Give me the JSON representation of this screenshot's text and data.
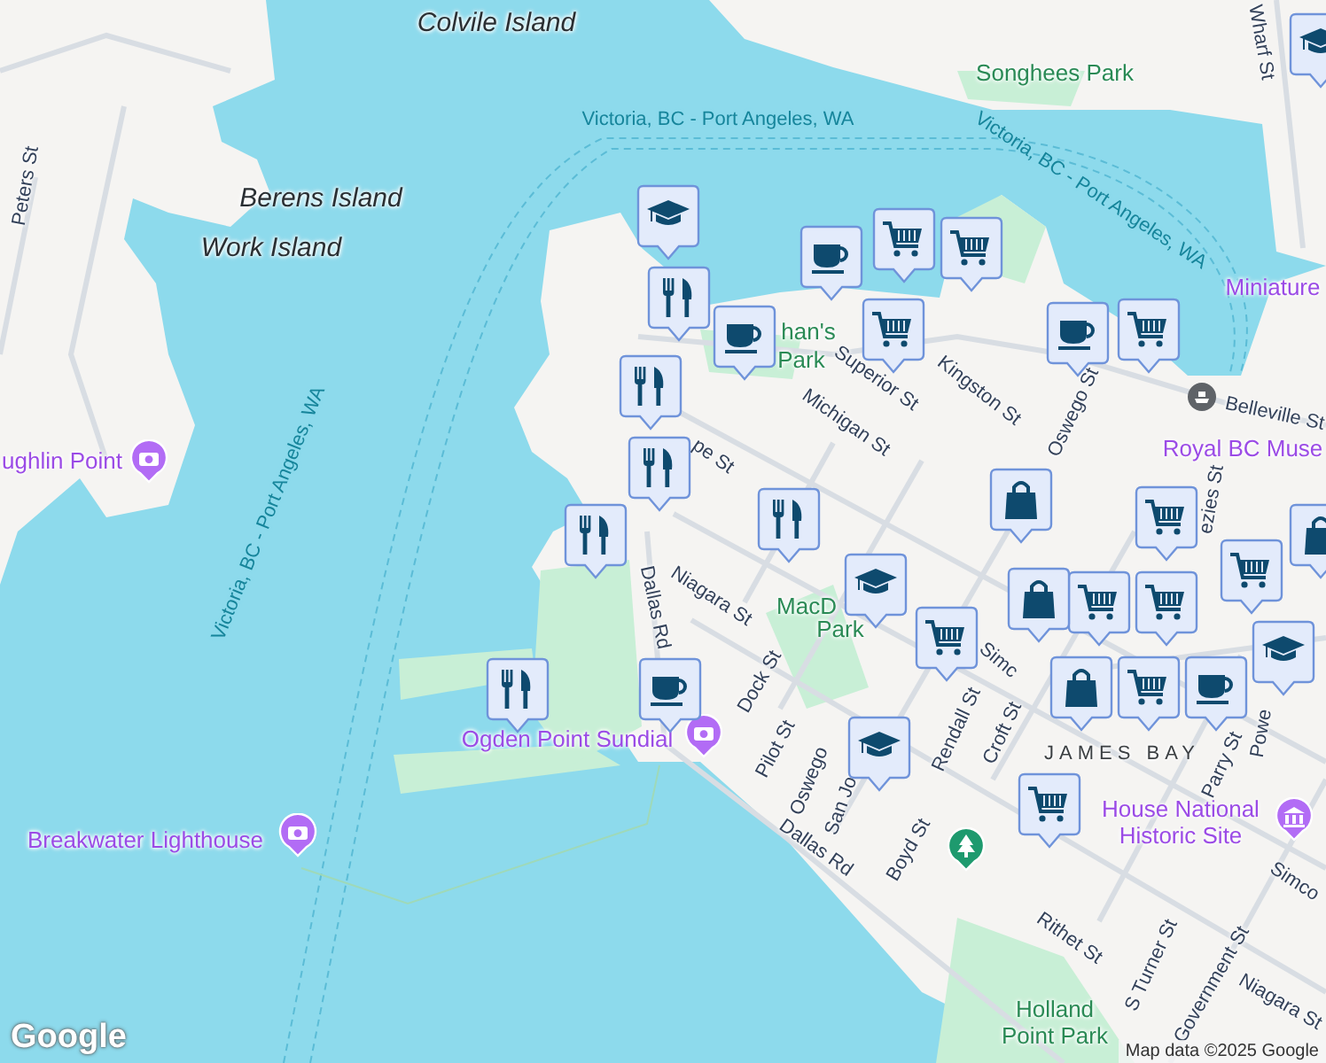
{
  "labels": [
    {
      "text": "Colvile Island",
      "kind": "island"
    },
    {
      "text": "Berens Island",
      "kind": "island"
    },
    {
      "text": "Work Island",
      "kind": "island"
    },
    {
      "text": "Victoria, BC - Port Angeles, WA",
      "kind": "route"
    },
    {
      "text": "Victoria, BC - Port Angeles, WA",
      "kind": "route"
    },
    {
      "text": "Victoria, BC - Port Angeles, WA",
      "kind": "route"
    },
    {
      "text": "Peters St",
      "kind": "street"
    },
    {
      "text": "Songhees Park",
      "kind": "park"
    },
    {
      "text": "han's",
      "kind": "park"
    },
    {
      "text": "Park",
      "kind": "park"
    },
    {
      "text": "Superior St",
      "kind": "street"
    },
    {
      "text": "Kingston St",
      "kind": "street"
    },
    {
      "text": "Michigan St",
      "kind": "street"
    },
    {
      "text": "Oswego St",
      "kind": "street"
    },
    {
      "text": "Belleville St",
      "kind": "street"
    },
    {
      "text": "pe St",
      "kind": "street"
    },
    {
      "text": "Miniature",
      "kind": "poi"
    },
    {
      "text": "Royal BC Muse",
      "kind": "poi"
    },
    {
      "text": "ezies St",
      "kind": "street"
    },
    {
      "text": "Wharf St",
      "kind": "street"
    },
    {
      "text": "ughlin Point",
      "kind": "poi"
    },
    {
      "text": "Dallas Rd",
      "kind": "street"
    },
    {
      "text": "Niagara St",
      "kind": "street"
    },
    {
      "text": "MacD",
      "kind": "park"
    },
    {
      "text": "Park",
      "kind": "park"
    },
    {
      "text": "Dock St",
      "kind": "street"
    },
    {
      "text": "Pilot St",
      "kind": "street"
    },
    {
      "text": "Oswego",
      "kind": "street"
    },
    {
      "text": "San Jo",
      "kind": "street"
    },
    {
      "text": "Dallas Rd",
      "kind": "street"
    },
    {
      "text": "Boyd St",
      "kind": "street"
    },
    {
      "text": "Rendall St",
      "kind": "street"
    },
    {
      "text": "Simc",
      "kind": "street"
    },
    {
      "text": "Croft St",
      "kind": "street"
    },
    {
      "text": "JAMES BAY",
      "kind": "area"
    },
    {
      "text": "House National Historic Site",
      "kind": "poi"
    },
    {
      "text": "Parry St",
      "kind": "street"
    },
    {
      "text": "Powe",
      "kind": "street"
    },
    {
      "text": "Simco",
      "kind": "street"
    },
    {
      "text": "Rithet St",
      "kind": "street"
    },
    {
      "text": "S Turner St",
      "kind": "street"
    },
    {
      "text": "Government St",
      "kind": "street"
    },
    {
      "text": "Niagara St",
      "kind": "street"
    },
    {
      "text": "Holland Point Park",
      "kind": "park"
    },
    {
      "text": "Breakwater Lighthouse",
      "kind": "poi"
    },
    {
      "text": "Ogden Point Sundial",
      "kind": "poi"
    }
  ],
  "markers": [
    {
      "kind": "camera"
    },
    {
      "kind": "camera"
    },
    {
      "kind": "camera"
    },
    {
      "kind": "museum"
    },
    {
      "kind": "tree"
    },
    {
      "kind": "ferry"
    }
  ],
  "pins": [
    {
      "kind": "school"
    },
    {
      "kind": "restaurant"
    },
    {
      "kind": "cafe"
    },
    {
      "kind": "cafe"
    },
    {
      "kind": "grocery"
    },
    {
      "kind": "grocery"
    },
    {
      "kind": "grocery"
    },
    {
      "kind": "cafe"
    },
    {
      "kind": "grocery"
    },
    {
      "kind": "restaurant"
    },
    {
      "kind": "restaurant"
    },
    {
      "kind": "restaurant"
    },
    {
      "kind": "restaurant"
    },
    {
      "kind": "shopping"
    },
    {
      "kind": "grocery"
    },
    {
      "kind": "school"
    },
    {
      "kind": "shopping"
    },
    {
      "kind": "grocery"
    },
    {
      "kind": "grocery"
    },
    {
      "kind": "school"
    },
    {
      "kind": "grocery"
    },
    {
      "kind": "shopping"
    },
    {
      "kind": "grocery"
    },
    {
      "kind": "cafe"
    },
    {
      "kind": "grocery"
    },
    {
      "kind": "shopping"
    },
    {
      "kind": "school"
    },
    {
      "kind": "restaurant"
    },
    {
      "kind": "cafe"
    },
    {
      "kind": "school"
    },
    {
      "kind": "grocery"
    }
  ],
  "attribution": {
    "logo": "Google",
    "text": "Map data ©2025 Google"
  }
}
